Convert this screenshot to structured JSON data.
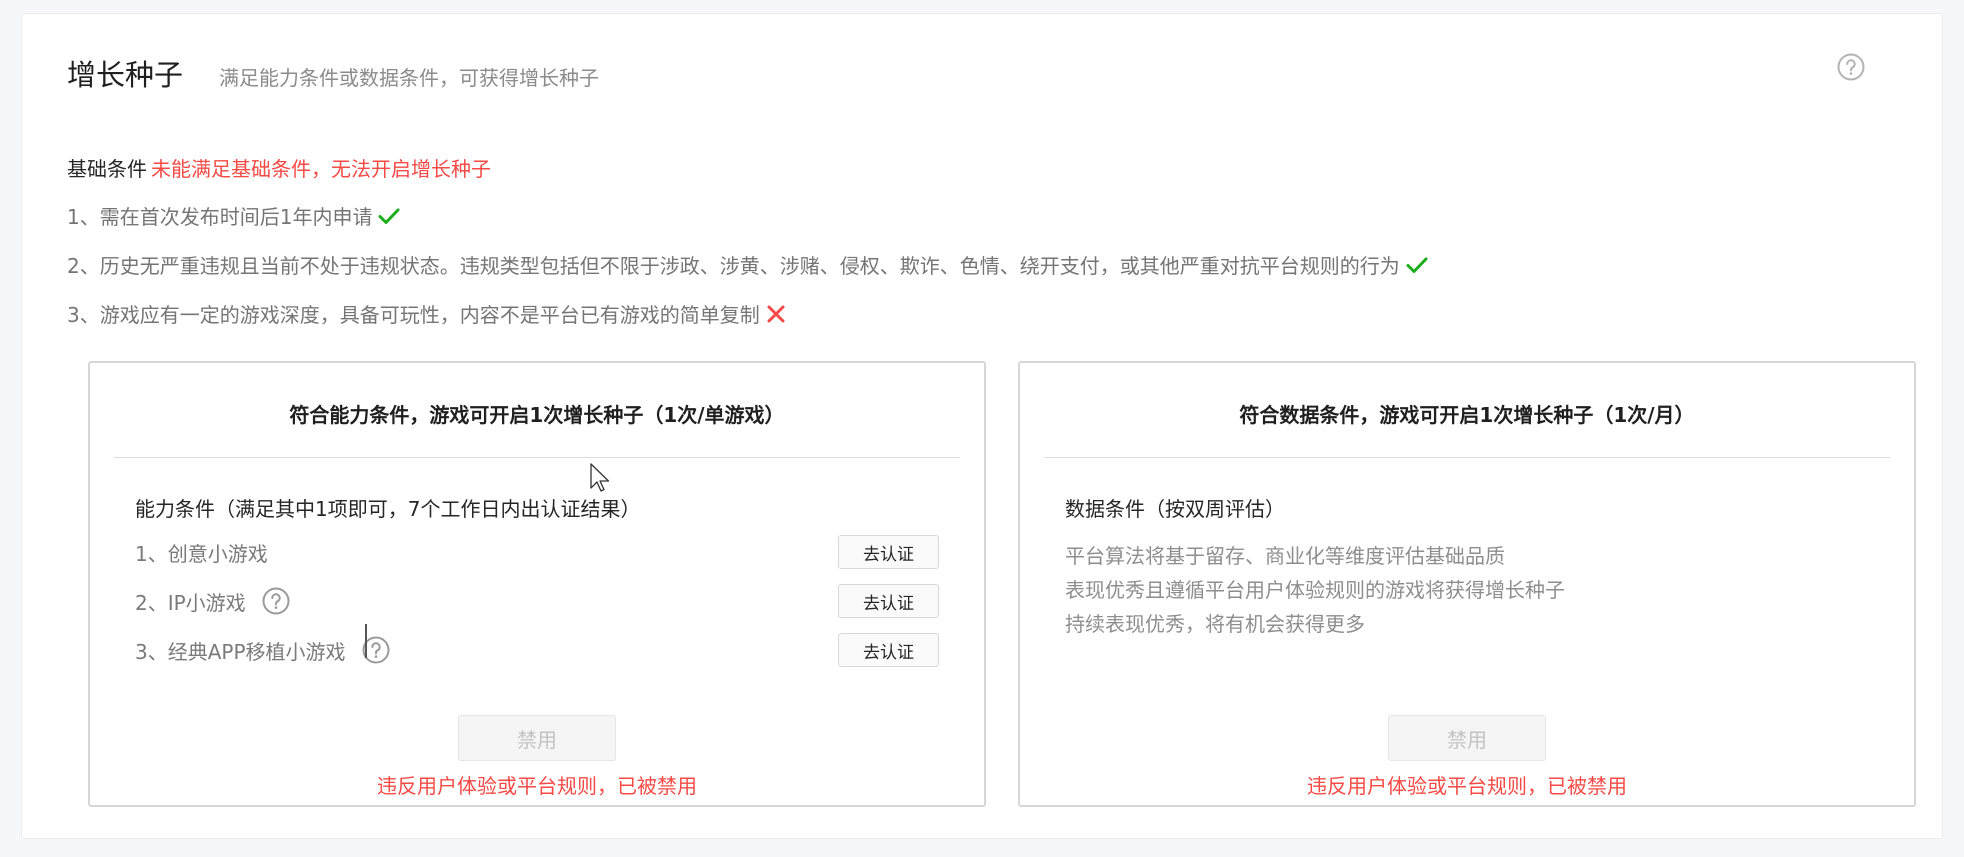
{
  "header": {
    "title": "增长种子",
    "subtitle": "满足能力条件或数据条件，可获得增长种子"
  },
  "basic": {
    "label": "基础条件",
    "warning": "未能满足基础条件，无法开启增长种子",
    "conditions": [
      {
        "text": "1、需在首次发布时间后1年内申请",
        "status": "pass"
      },
      {
        "text": "2、历史无严重违规且当前不处于违规状态。违规类型包括但不限于涉政、涉黄、涉赌、侵权、欺诈、色情、绕开支付，或其他严重对抗平台规则的行为",
        "status": "pass"
      },
      {
        "text": "3、游戏应有一定的游戏深度，具备可玩性，内容不是平台已有游戏的简单复制",
        "status": "fail"
      }
    ]
  },
  "ability_card": {
    "title": "符合能力条件，游戏可开启1次增长种子（1次/单游戏）",
    "section_title": "能力条件（满足其中1项即可，7个工作日内出认证结果）",
    "items": [
      {
        "label": "1、创意小游戏",
        "button": "去认证"
      },
      {
        "label": "2、IP小游戏",
        "button": "去认证"
      },
      {
        "label": "3、经典APP移植小游戏",
        "button": "去认证"
      }
    ],
    "disabled_button": "禁用",
    "ban_text": "违反用户体验或平台规则，已被禁用"
  },
  "data_card": {
    "title": "符合数据条件，游戏可开启1次增长种子（1次/月）",
    "section_title": "数据条件（按双周评估）",
    "description": [
      "平台算法将基于留存、商业化等维度评估基础品质",
      "表现优秀且遵循平台用户体验规则的游戏将获得增长种子",
      "持续表现优秀，将有机会获得更多"
    ],
    "disabled_button": "禁用",
    "ban_text": "违反用户体验或平台规则，已被禁用"
  },
  "colors": {
    "warning": "#f54a45",
    "pass": "#1aad19",
    "fail": "#f54a45"
  },
  "icons": {
    "help": "question-circle-icon",
    "pass": "check-icon",
    "fail": "cross-icon"
  }
}
